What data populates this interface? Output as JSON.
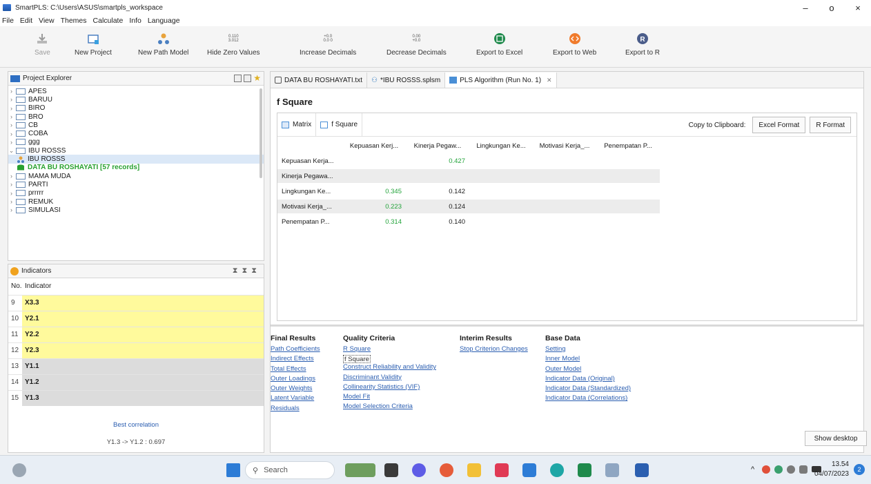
{
  "window": {
    "title": "SmartPLS: C:\\Users\\ASUS\\smartpls_workspace",
    "controls": [
      "–",
      "o",
      "×"
    ]
  },
  "menu": [
    "File",
    "Edit",
    "View",
    "Themes",
    "Calculate",
    "Info",
    "Language"
  ],
  "toolbar": {
    "save": "Save",
    "new_project": "New Project",
    "new_path_model": "New Path Model",
    "hide_zero_icon_line1": "0.110",
    "hide_zero_icon_line2": "3.012",
    "hide_zero_values": "Hide Zero Values",
    "increase_icon_line1": "+0.0",
    "increase_icon_line2": "0.0 0",
    "increase_decimals": "Increase Decimals",
    "decrease_icon_line1": "0.00",
    "decrease_icon_line2": "+0.0",
    "decrease_decimals": "Decrease Decimals",
    "export_excel": "Export to Excel",
    "export_web": "Export to Web",
    "export_r": "Export to R"
  },
  "project_explorer": {
    "title": "Project Explorer",
    "items": [
      {
        "label": "APES",
        "expanded": false
      },
      {
        "label": "BARUU",
        "expanded": false
      },
      {
        "label": "BIRO",
        "expanded": false
      },
      {
        "label": "BRO",
        "expanded": false
      },
      {
        "label": "CB",
        "expanded": false
      },
      {
        "label": "COBA",
        "expanded": false
      },
      {
        "label": "ggg",
        "expanded": false
      },
      {
        "label": "IBU ROSSS",
        "expanded": true
      },
      {
        "label": "IBU ROSSS",
        "child": "model"
      },
      {
        "label": "DATA BU ROSHAYATI [57 records]",
        "child": "data"
      },
      {
        "label": "MAMA MUDA",
        "expanded": false
      },
      {
        "label": "PARTI",
        "expanded": false
      },
      {
        "label": "prrrrr",
        "expanded": false
      },
      {
        "label": "REMUK",
        "expanded": false
      },
      {
        "label": "SIMULASI",
        "expanded": false
      }
    ]
  },
  "indicators": {
    "title": "Indicators",
    "col_no": "No.",
    "col_indicator": "Indicator",
    "rows": [
      {
        "no": "9",
        "name": "X3.3",
        "highlight": "yellow"
      },
      {
        "no": "10",
        "name": "Y2.1",
        "highlight": "yellow"
      },
      {
        "no": "11",
        "name": "Y2.2",
        "highlight": "yellow"
      },
      {
        "no": "12",
        "name": "Y2.3",
        "highlight": "yellow"
      },
      {
        "no": "13",
        "name": "Y1.1",
        "highlight": "gray"
      },
      {
        "no": "14",
        "name": "Y1.2",
        "highlight": "gray"
      },
      {
        "no": "15",
        "name": "Y1.3",
        "highlight": "gray"
      }
    ],
    "best_correlation_label": "Best correlation",
    "best_correlation_value": "Y1.3 -> Y1.2 : 0.697"
  },
  "editor": {
    "tabs": [
      {
        "label": "DATA BU ROSHAYATI.txt",
        "active": false
      },
      {
        "label": "*IBU ROSSS.splsm",
        "active": false
      },
      {
        "label": "PLS Algorithm (Run No. 1)",
        "active": true,
        "close": "✕"
      }
    ],
    "section_title": "f Square",
    "subtabs": [
      "Matrix",
      "f Square"
    ],
    "copy_to_clipboard": "Copy to Clipboard:",
    "excel_format": "Excel Format",
    "r_format": "R Format"
  },
  "matrix": {
    "columns": [
      "Kepuasan Kerj...",
      "Kinerja Pegaw...",
      "Lingkungan Ke...",
      "Motivasi Kerja_...",
      "Penempatan P..."
    ],
    "rows": [
      {
        "label": "Kepuasan Kerja...",
        "values": [
          "",
          "0.427",
          "",
          "",
          ""
        ]
      },
      {
        "label": "Kinerja Pegawa...",
        "values": [
          "",
          "",
          "",
          "",
          ""
        ]
      },
      {
        "label": "Lingkungan Ke...",
        "values": [
          "0.345",
          "0.142",
          "",
          "",
          ""
        ]
      },
      {
        "label": "Motivasi Kerja_...",
        "values": [
          "0.223",
          "0.124",
          "",
          "",
          ""
        ]
      },
      {
        "label": "Penempatan P...",
        "values": [
          "0.314",
          "0.140",
          "",
          "",
          ""
        ]
      }
    ]
  },
  "results": {
    "final": {
      "title": "Final Results",
      "links": [
        "Path Coefficients",
        "Indirect Effects",
        "Total Effects",
        "Outer Loadings",
        "Outer Weights",
        "Latent Variable",
        "Residuals"
      ]
    },
    "quality": {
      "title": "Quality Criteria",
      "links": [
        "R Square",
        "f Square",
        "Construct Reliability and Validity",
        "Discriminant Validity",
        "Collinearity Statistics (VIF)",
        "Model Fit",
        "Model Selection Criteria"
      ]
    },
    "interim": {
      "title": "Interim Results",
      "links": [
        "Stop Criterion Changes"
      ]
    },
    "base": {
      "title": "Base Data",
      "links": [
        "Setting",
        "Inner Model",
        "Outer Model",
        "Indicator Data (Original)",
        "Indicator Data (Standardized)",
        "Indicator Data (Correlations)"
      ]
    }
  },
  "show_desktop": "Show desktop",
  "taskbar": {
    "search_placeholder": "Search",
    "time": "13.54",
    "date": "04/07/2023",
    "notification_count": "2",
    "tray_chevron": "^"
  },
  "colors": {
    "green_value": "#22a33a",
    "link": "#2a5db0",
    "yellow_highlight": "#fffa9c",
    "gray_highlight": "#dcdcdc"
  }
}
